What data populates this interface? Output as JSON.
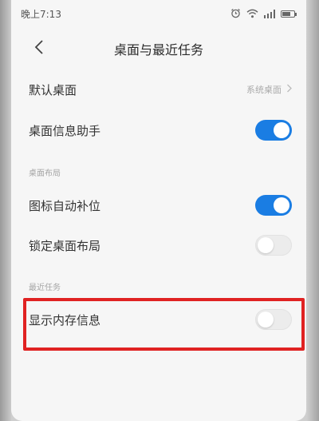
{
  "status": {
    "time": "晚上7:13",
    "icons": [
      "alarm-icon",
      "wifi-icon",
      "signal-icon",
      "battery-icon"
    ]
  },
  "header": {
    "back_icon": "chevron-left-icon",
    "title": "桌面与最近任务"
  },
  "rows": {
    "default_desktop": {
      "label": "默认桌面",
      "value": "系统桌面"
    },
    "desktop_assistant": {
      "label": "桌面信息助手",
      "enabled": true
    },
    "auto_fill_icons": {
      "label": "图标自动补位",
      "enabled": true
    },
    "lock_layout": {
      "label": "锁定桌面布局",
      "enabled": false
    },
    "show_memory": {
      "label": "显示内存信息",
      "enabled": false
    }
  },
  "sections": {
    "desktop_layout": "桌面布局",
    "recent_tasks": "最近任务"
  },
  "colors": {
    "toggle_on": "#1a7de3",
    "toggle_off": "#ececec",
    "highlight": "#e02222",
    "background": "#f6f6f6"
  }
}
